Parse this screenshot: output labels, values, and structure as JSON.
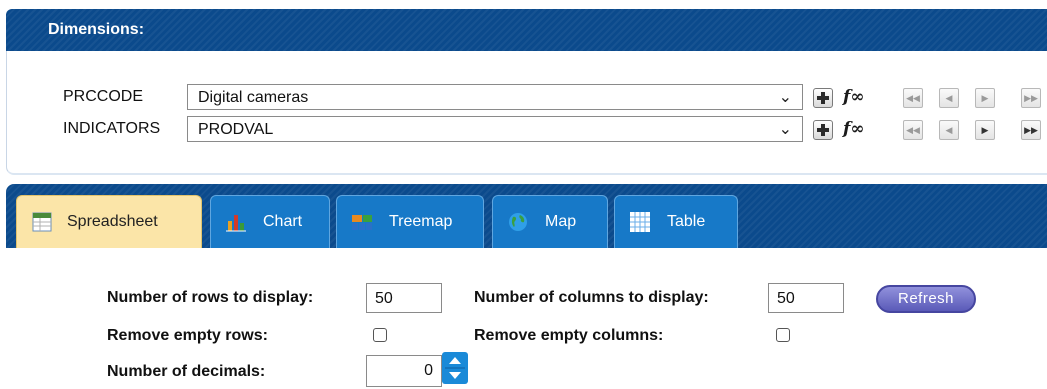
{
  "dimensions": {
    "title": "Dimensions:",
    "rows": [
      {
        "label": "PRCCODE",
        "value": "Digital cameras",
        "fx": "f∞"
      },
      {
        "label": "INDICATORS",
        "value": "PRODVAL",
        "fx": "f∞"
      }
    ]
  },
  "tabs": [
    {
      "label": "Spreadsheet",
      "icon": "spreadsheet-icon",
      "active": true
    },
    {
      "label": "Chart",
      "icon": "bar-chart-icon",
      "active": false
    },
    {
      "label": "Treemap",
      "icon": "treemap-icon",
      "active": false
    },
    {
      "label": "Map",
      "icon": "globe-icon",
      "active": false
    },
    {
      "label": "Table",
      "icon": "table-grid-icon",
      "active": false
    }
  ],
  "options": {
    "rows_label": "Number of rows to display:",
    "rows_value": "50",
    "cols_label": "Number of columns to display:",
    "cols_value": "50",
    "refresh_label": "Refresh",
    "empty_rows_label": "Remove empty rows:",
    "empty_cols_label": "Remove empty columns:",
    "decimals_label": "Number of decimals:",
    "decimals_value": "0"
  },
  "colors": {
    "header_blue": "#0b4a8c",
    "tab_blue": "#1779c8",
    "active_tab": "#fbe5a8",
    "refresh": "#6a6ac8"
  }
}
